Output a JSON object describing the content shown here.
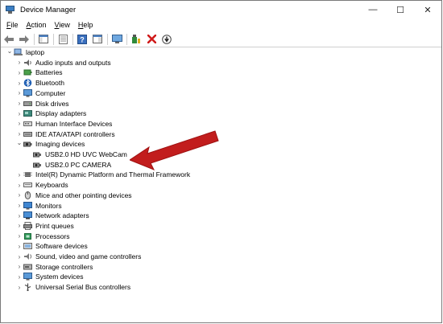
{
  "window": {
    "title": "Device Manager",
    "controls": [
      "—",
      "☐",
      "✕"
    ]
  },
  "menu": [
    {
      "label": "File",
      "mnemonic": "F",
      "rest": "ile"
    },
    {
      "label": "Action",
      "mnemonic": "A",
      "rest": "ction"
    },
    {
      "label": "View",
      "mnemonic": "V",
      "rest": "iew"
    },
    {
      "label": "Help",
      "mnemonic": "H",
      "rest": "elp"
    }
  ],
  "toolbar": {
    "icons": [
      "back-icon",
      "forward-icon",
      "show-hide-console-tree-icon",
      "properties-icon",
      "help-icon",
      "action-pane-icon",
      "monitor-icon",
      "update-driver-icon",
      "uninstall-icon",
      "scan-hardware-icon"
    ]
  },
  "tree": {
    "root": "laptop",
    "categories": [
      {
        "label": "Audio inputs and outputs",
        "expanded": false
      },
      {
        "label": "Batteries",
        "expanded": false
      },
      {
        "label": "Bluetooth",
        "expanded": false
      },
      {
        "label": "Computer",
        "expanded": false
      },
      {
        "label": "Disk drives",
        "expanded": false
      },
      {
        "label": "Display adapters",
        "expanded": false
      },
      {
        "label": "Human Interface Devices",
        "expanded": false
      },
      {
        "label": "IDE ATA/ATAPI controllers",
        "expanded": false
      },
      {
        "label": "Imaging devices",
        "expanded": true,
        "children": [
          "USB2.0 HD UVC WebCam",
          "USB2.0 PC CAMERA"
        ]
      },
      {
        "label": "Intel(R) Dynamic Platform and Thermal Framework",
        "expanded": false
      },
      {
        "label": "Keyboards",
        "expanded": false
      },
      {
        "label": "Mice and other pointing devices",
        "expanded": false
      },
      {
        "label": "Monitors",
        "expanded": false
      },
      {
        "label": "Network adapters",
        "expanded": false
      },
      {
        "label": "Print queues",
        "expanded": false
      },
      {
        "label": "Processors",
        "expanded": false
      },
      {
        "label": "Software devices",
        "expanded": false
      },
      {
        "label": "Sound, video and game controllers",
        "expanded": false
      },
      {
        "label": "Storage controllers",
        "expanded": false
      },
      {
        "label": "System devices",
        "expanded": false
      },
      {
        "label": "Universal Serial Bus controllers",
        "expanded": false
      }
    ]
  },
  "colors": {
    "arrow": "#c21d1d",
    "monitor_blue": "#3c7fc4"
  }
}
